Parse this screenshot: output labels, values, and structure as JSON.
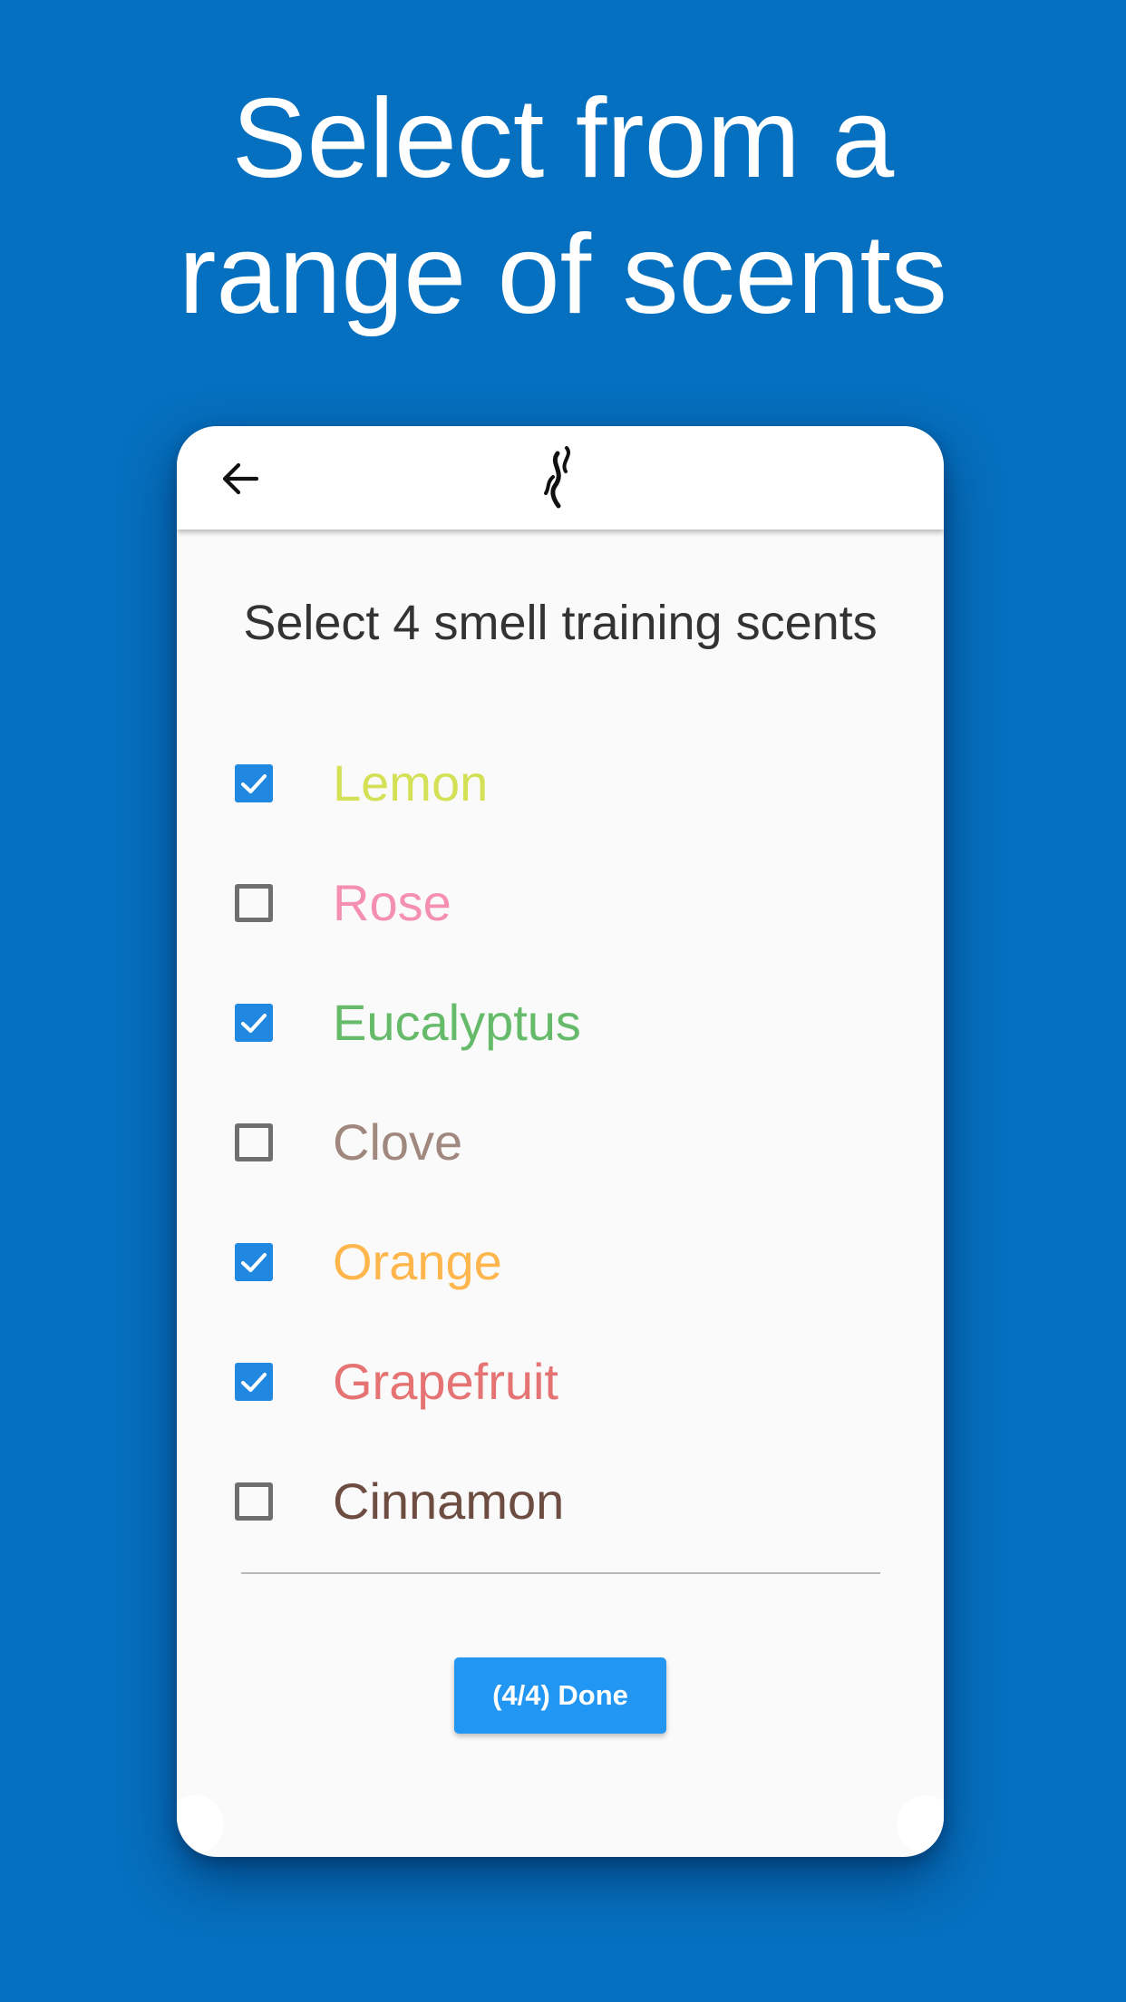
{
  "headline": {
    "line1": "Select from a",
    "line2": "range of scents"
  },
  "app": {
    "back_icon": "arrow-left-icon",
    "logo_icon": "scent-wisp-icon",
    "prompt": "Select 4 smell training scents",
    "scents": [
      {
        "label": "Lemon",
        "checked": true,
        "color": "#d4e157"
      },
      {
        "label": "Rose",
        "checked": false,
        "color": "#f48fb1"
      },
      {
        "label": "Eucalyptus",
        "checked": true,
        "color": "#66bb6a"
      },
      {
        "label": "Clove",
        "checked": false,
        "color": "#a1887f"
      },
      {
        "label": "Orange",
        "checked": true,
        "color": "#ffb74d"
      },
      {
        "label": "Grapefruit",
        "checked": true,
        "color": "#e57373"
      },
      {
        "label": "Cinnamon",
        "checked": false,
        "color": "#6d4c41"
      }
    ],
    "done_label": "(4/4) Done"
  },
  "colors": {
    "background": "#0570bf",
    "accent": "#2196f3",
    "checkbox_checked": "#2188e2"
  }
}
